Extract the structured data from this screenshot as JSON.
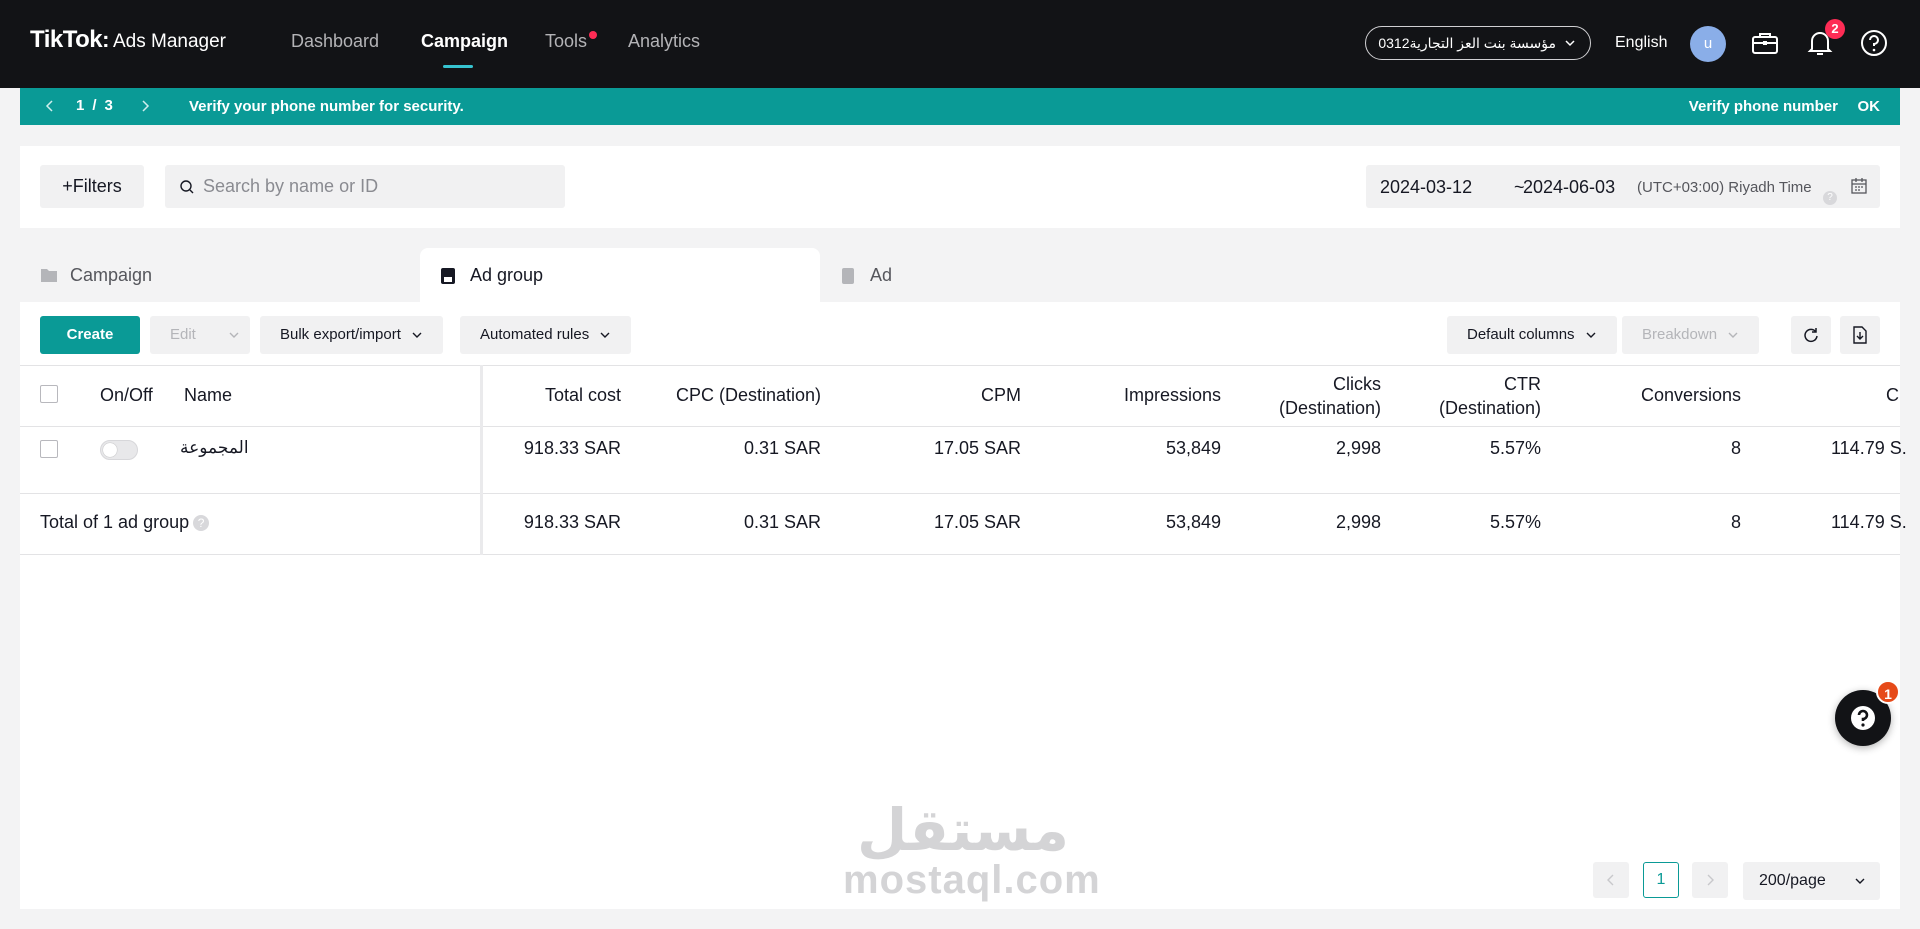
{
  "header": {
    "logo": "TikTok",
    "logo_sub": "Ads Manager",
    "nav": [
      "Dashboard",
      "Campaign",
      "Tools",
      "Analytics"
    ],
    "account": "مؤسسة بنت العز التجارية0312",
    "language": "English",
    "avatar_initial": "u",
    "notification_count": "2"
  },
  "banner": {
    "page_current": "1",
    "page_sep": "/",
    "page_total": "3",
    "message": "Verify your phone number for security.",
    "verify_link": "Verify phone number",
    "ok": "OK"
  },
  "filters": {
    "button": "+Filters",
    "search_placeholder": "Search by name or ID",
    "date_start": "2024-03-12",
    "date_sep": "~",
    "date_end": "2024-06-03",
    "timezone": "(UTC+03:00) Riyadh Time"
  },
  "level_tabs": [
    "Campaign",
    "Ad group",
    "Ad"
  ],
  "toolbar": {
    "create": "Create",
    "edit": "Edit",
    "bulk": "Bulk export/import",
    "rules": "Automated rules",
    "columns": "Default columns",
    "breakdown": "Breakdown"
  },
  "table": {
    "headers": {
      "onoff": "On/Off",
      "name": "Name",
      "total_cost": "Total cost",
      "cpc": "CPC (Destination)",
      "cpm": "CPM",
      "impressions": "Impressions",
      "clicks_1": "Clicks",
      "clicks_2": "(Destination)",
      "ctr_1": "CTR",
      "ctr_2": "(Destination)",
      "conversions": "Conversions",
      "cut": "C"
    },
    "row": {
      "name": "المجموعة",
      "total_cost": "918.33 SAR",
      "cpc": "0.31 SAR",
      "cpm": "17.05 SAR",
      "impressions": "53,849",
      "clicks": "2,998",
      "ctr": "5.57%",
      "conversions": "8",
      "cut": "114.79 S."
    },
    "total": {
      "label": "Total of 1 ad group",
      "help": "?",
      "total_cost": "918.33 SAR",
      "cpc": "0.31 SAR",
      "cpm": "17.05 SAR",
      "impressions": "53,849",
      "clicks": "2,998",
      "ctr": "5.57%",
      "conversions": "8",
      "cut": "114.79 S."
    }
  },
  "pagination": {
    "page": "1",
    "page_size": "200/page"
  },
  "watermark": {
    "arabic": "مستقل",
    "latin": "mostaql.com"
  },
  "help_badge": "1",
  "colors": {
    "accent": "#0a9a96",
    "nav_bg": "#121316",
    "alert": "#fe2c55"
  }
}
